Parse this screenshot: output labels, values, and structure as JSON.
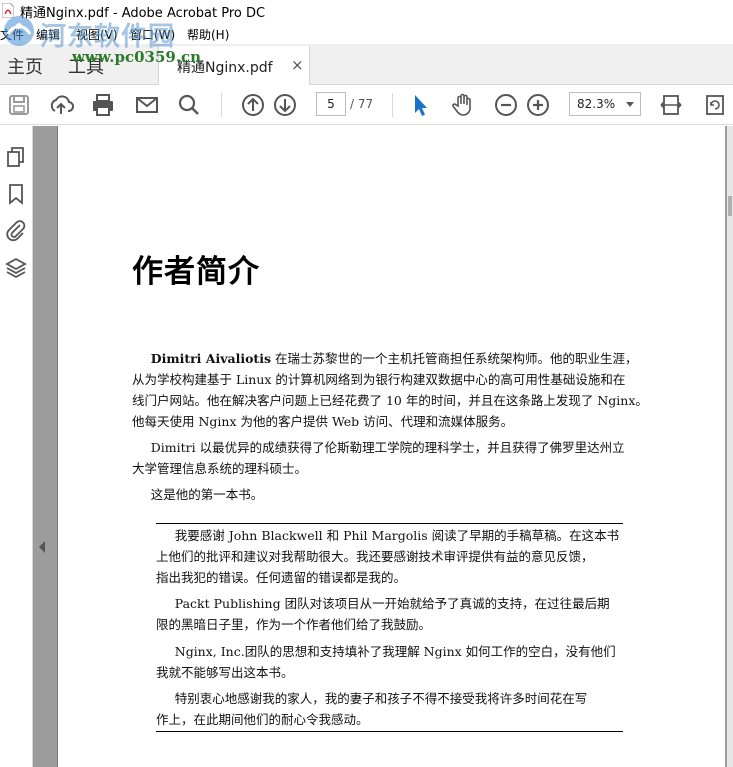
{
  "window": {
    "title": "精通Nginx.pdf - Adobe Acrobat Pro DC"
  },
  "menu": {
    "items": [
      "文件",
      "编辑",
      "视图(V)",
      "窗口(W)",
      "帮助(H)"
    ]
  },
  "watermark": {
    "text": "河东软件园",
    "url": "www.pc0359.cn"
  },
  "tabs": {
    "home": "主页",
    "tools": "工具",
    "document": "精通Nginx.pdf",
    "close": "×"
  },
  "toolbar": {
    "current_page": "5",
    "total_pages": "/ 77",
    "zoom": "82.3%",
    "icons": [
      "save-icon",
      "upload-icon",
      "print-icon",
      "email-icon",
      "search-icon",
      "page-up-icon",
      "page-down-icon",
      "select-pointer-icon",
      "hand-tool-icon",
      "zoom-out-icon",
      "zoom-in-icon",
      "fit-page-icon",
      "rotate-page-icon"
    ],
    "accent": "#1a73c8"
  },
  "sidebar": {
    "icons": [
      "page-thumbnails-icon",
      "bookmarks-icon",
      "attachments-icon",
      "layers-icon"
    ]
  },
  "document": {
    "heading": "作者简介",
    "paragraphs": [
      {
        "bold": "Dimitri  Aivaliotis",
        "line1": " 在瑞士苏黎世的一个主机托管商担任系统架构师。他的职业生涯，",
        "line2": "从为学校构建基于 Linux 的计算机网络到为银行构建双数据中心的高可用性基础设施和在",
        "line3": "线门户网站。他在解决客户问题上已经花费了 10 年的时间，并且在这条路上发现了 Nginx。",
        "line4": "他每天使用 Nginx 为他的客户提供 Web 访问、代理和流媒体服务。"
      },
      {
        "line1": "Dimitri  以最优异的成绩获得了伦斯勒理工学院的理科学士，并且获得了佛罗里达州立",
        "line2": "大学管理信息系统的理科硕士。"
      },
      {
        "line1": "这是他的第一本书。"
      }
    ],
    "acknowledgements": [
      {
        "line1": "我要感谢 John Blackwell 和 Phil Margolis 阅读了早期的手稿草稿。在这本书",
        "line2": "上他们的批评和建议对我帮助很大。我还要感谢技术审评提供有益的意见反馈，",
        "line3": "指出我犯的错误。任何遗留的错误都是我的。"
      },
      {
        "line1": "Packt  Publishing 团队对该项目从一开始就给予了真诚的支持，在过往最后期",
        "line2": "限的黑暗日子里，作为一个作者他们给了我鼓励。"
      },
      {
        "line1": "Nginx, Inc.团队的思想和支持填补了我理解 Nginx 如何工作的空白，没有他们",
        "line2": "我就不能够写出这本书。"
      },
      {
        "line1": "特别衷心地感谢我的家人，我的妻子和孩子不得不接受我将许多时间花在写",
        "line2": "作上，在此期间他们的耐心令我感动。"
      }
    ]
  }
}
